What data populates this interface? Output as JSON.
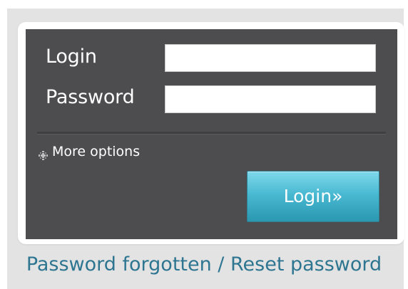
{
  "form": {
    "login_label": "Login",
    "password_label": "Password",
    "login_value": "",
    "password_value": "",
    "more_options_label": "More options",
    "submit_label": "Login»"
  },
  "footer": {
    "reset_link": "Password forgotten / Reset password"
  },
  "colors": {
    "panel": "#4d4d4f",
    "button": "#49b9d2",
    "link": "#2d7590"
  },
  "icons": {
    "more_options": "plus-grid-icon"
  }
}
